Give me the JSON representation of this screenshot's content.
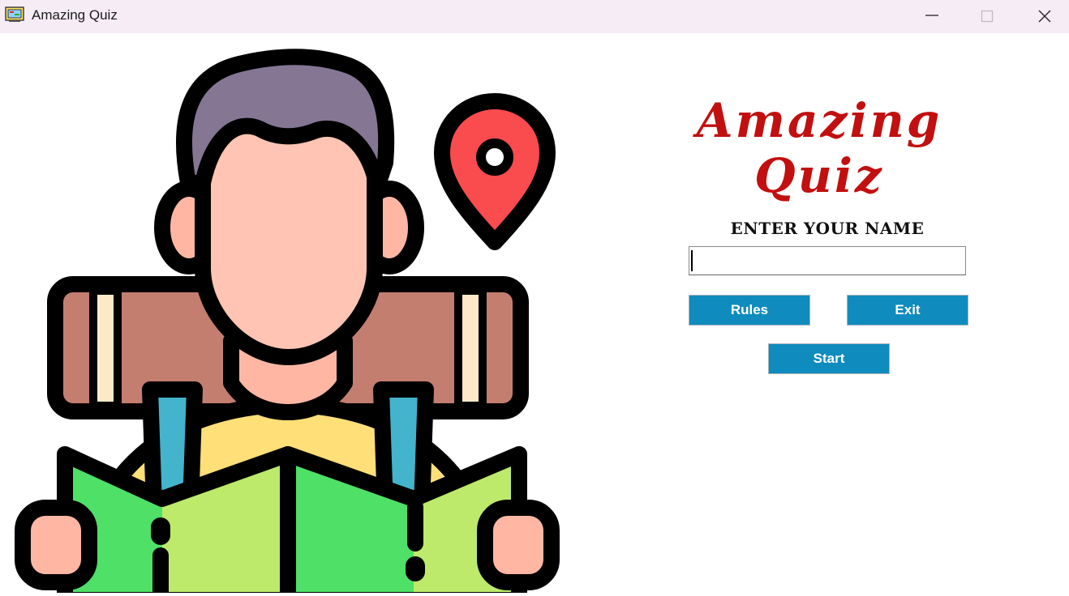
{
  "window": {
    "title": "Amazing Quiz",
    "controls": [
      "minimize-icon",
      "maximize-icon",
      "close-icon"
    ]
  },
  "main": {
    "heading": "Amazing Quiz",
    "name_label": "ENTER YOUR NAME",
    "name_value": "",
    "buttons": {
      "rules": "Rules",
      "exit": "Exit",
      "start": "Start"
    }
  },
  "colors": {
    "heading": "#c20f0f",
    "button": "#108bbd",
    "titlebar": "#f5ecf6"
  },
  "illustration": "backpacker-with-map-and-location-pin"
}
